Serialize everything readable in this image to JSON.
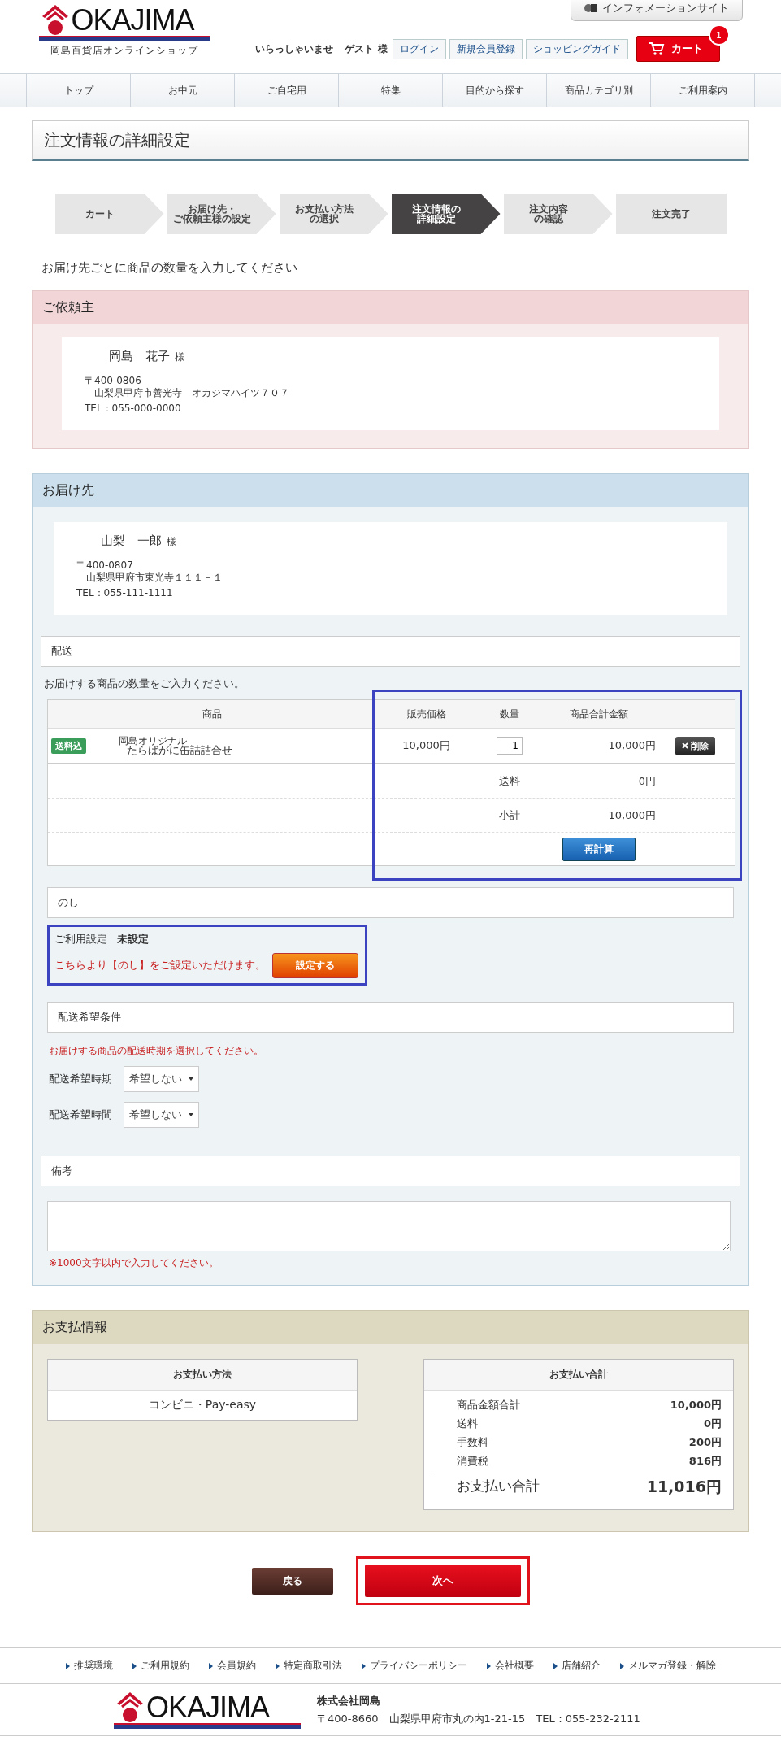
{
  "header": {
    "logo": {
      "wordmark": "OKAJIMA",
      "subtitle": "岡島百貨店オンラインショップ"
    },
    "info_site_button": "インフォメーションサイト",
    "greeting": "いらっしゃいませ",
    "user": "ゲスト",
    "honorific": "様",
    "links": [
      "ログイン",
      "新規会員登録",
      "ショッピングガイド"
    ],
    "cart": {
      "label": "カート",
      "badge": "1"
    }
  },
  "nav": [
    "トップ",
    "お中元",
    "ご自宅用",
    "特集",
    "目的から探す",
    "商品カテゴリ別",
    "ご利用案内"
  ],
  "page_title": "注文情報の詳細設定",
  "steps": [
    {
      "lines": [
        "カート"
      ],
      "selected": false
    },
    {
      "lines": [
        "お届け先・",
        "ご依頼主様の設定"
      ],
      "selected": false
    },
    {
      "lines": [
        "お支払い方法",
        "の選択"
      ],
      "selected": false
    },
    {
      "lines": [
        "注文情報の",
        "詳細設定"
      ],
      "selected": true
    },
    {
      "lines": [
        "注文内容",
        "の確認"
      ],
      "selected": false
    },
    {
      "lines": [
        "注文完了"
      ],
      "selected": false
    }
  ],
  "instruction": "お届け先ごとに商品の数量を入力してください",
  "requester": {
    "title": "ご依頼主",
    "name": "岡島　花子",
    "honorific": "様",
    "postal": "〒400-0806",
    "address": "山梨県甲府市善光寺　オカジマハイツ７０７",
    "tel": "TEL：055-000-0000"
  },
  "recipient": {
    "title": "お届け先",
    "name": "山梨　一郎",
    "honorific": "様",
    "postal": "〒400-0807",
    "address": "山梨県甲府市東光寺１１１－１",
    "tel": "TEL：055-111-1111"
  },
  "delivery": {
    "title": "配送",
    "note": "お届けする商品の数量をご入力ください。",
    "columns": [
      "商品",
      "販売価格",
      "数量",
      "商品合計金額"
    ],
    "items": [
      {
        "tag": "送料込",
        "brand": "岡島オリジナル",
        "name": "たらばがに缶詰詰合せ",
        "price": "10,000円",
        "quantity": "1",
        "total": "10,000円",
        "delete_label": "削除"
      }
    ],
    "summary": [
      {
        "label": "送料",
        "value": "0円"
      },
      {
        "label": "小計",
        "value": "10,000円"
      }
    ],
    "recalc_button": "再計算"
  },
  "noshi": {
    "title": "のし",
    "setting_label": "ご利用設定",
    "setting_value": "未設定",
    "note": "こちらより【のし】をご設定いただけます。",
    "button": "設定する"
  },
  "shipping": {
    "title": "配送希望条件",
    "note": "お届けする商品の配送時期を選択してください。",
    "fields": [
      {
        "label": "配送希望時期",
        "value": "希望しない"
      },
      {
        "label": "配送希望時間",
        "value": "希望しない"
      }
    ]
  },
  "remarks": {
    "title": "備考",
    "note": "※1000文字以内で入力してください。"
  },
  "payment": {
    "title": "お支払情報",
    "method_title": "お支払い方法",
    "method": "コンビニ・Pay-easy",
    "total_title": "お支払い合計",
    "lines": [
      {
        "label": "商品金額合計",
        "value": "10,000円"
      },
      {
        "label": "送料",
        "value": "0円"
      },
      {
        "label": "手数料",
        "value": "200円"
      },
      {
        "label": "消費税",
        "value": "816円"
      }
    ],
    "grand_label": "お支払い合計",
    "grand_value": "11,016円"
  },
  "actions": {
    "back": "戻る",
    "next": "次へ"
  },
  "footer": {
    "links": [
      "推奨環境",
      "ご利用規約",
      "会員規約",
      "特定商取引法",
      "プライバシーポリシー",
      "会社概要",
      "店舗紹介",
      "メルマガ登録・解除"
    ],
    "logo": "OKAJIMA",
    "company": "株式会社岡島",
    "address": "〒400-8660　山梨県甲府市丸の内1-21-15　TEL：055-232-2111"
  }
}
